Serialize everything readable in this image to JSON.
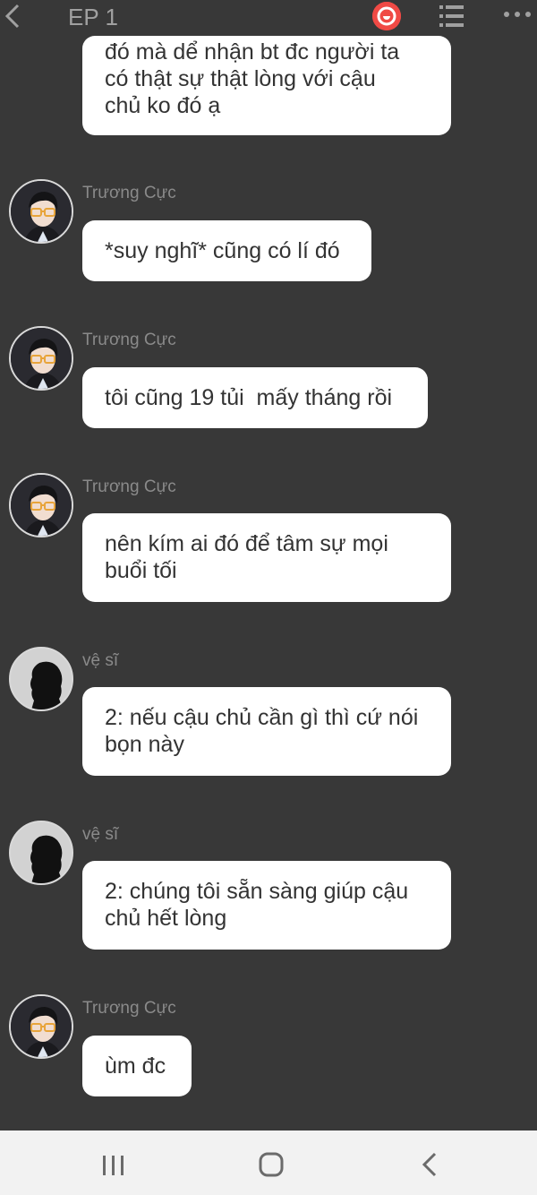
{
  "header": {
    "title": "EP 1",
    "icons": [
      "back-chevron",
      "record-button",
      "list-menu",
      "more-dots"
    ]
  },
  "messages": [
    {
      "id": "m0",
      "sender": "",
      "avatar": "",
      "text": [
        "đó mà dể nhận bt đc người ta",
        "có thật sự thật lòng với cậu",
        "chủ ko đó ạ"
      ]
    },
    {
      "id": "m1",
      "sender": "Trương Cực",
      "avatar": "boy-glasses",
      "text": [
        "*suy nghĩ* cũng có lí đó"
      ]
    },
    {
      "id": "m2",
      "sender": "Trương Cực",
      "avatar": "boy-glasses",
      "text": [
        "tôi cũng 19 tủi  mấy tháng rồi"
      ]
    },
    {
      "id": "m3",
      "sender": "Trương Cực",
      "avatar": "boy-glasses",
      "text": [
        "nên kím ai đó để tâm sự mọi",
        "buổi tối"
      ]
    },
    {
      "id": "m4",
      "sender": "vệ sĩ",
      "avatar": "silhouette",
      "text": [
        "2: nếu cậu chủ cần gì thì cứ nói",
        "bọn này"
      ]
    },
    {
      "id": "m5",
      "sender": "vệ sĩ",
      "avatar": "silhouette",
      "text": [
        "2: chúng tôi sẵn sàng giúp cậu",
        "chủ hết lòng"
      ]
    },
    {
      "id": "m6",
      "sender": "Trương Cực",
      "avatar": "boy-glasses",
      "text": [
        "ùm đc"
      ]
    }
  ],
  "colors": {
    "background": "#383838",
    "bubble": "#ffffff",
    "bubble_text": "#333333",
    "sender_text": "#8a8a8a",
    "title_text": "#a0a0a0",
    "record_button": "#f04a45",
    "nav_bar": "#f2f2f2"
  },
  "navbar": {
    "icons": [
      "recent-apps",
      "home",
      "back"
    ]
  }
}
